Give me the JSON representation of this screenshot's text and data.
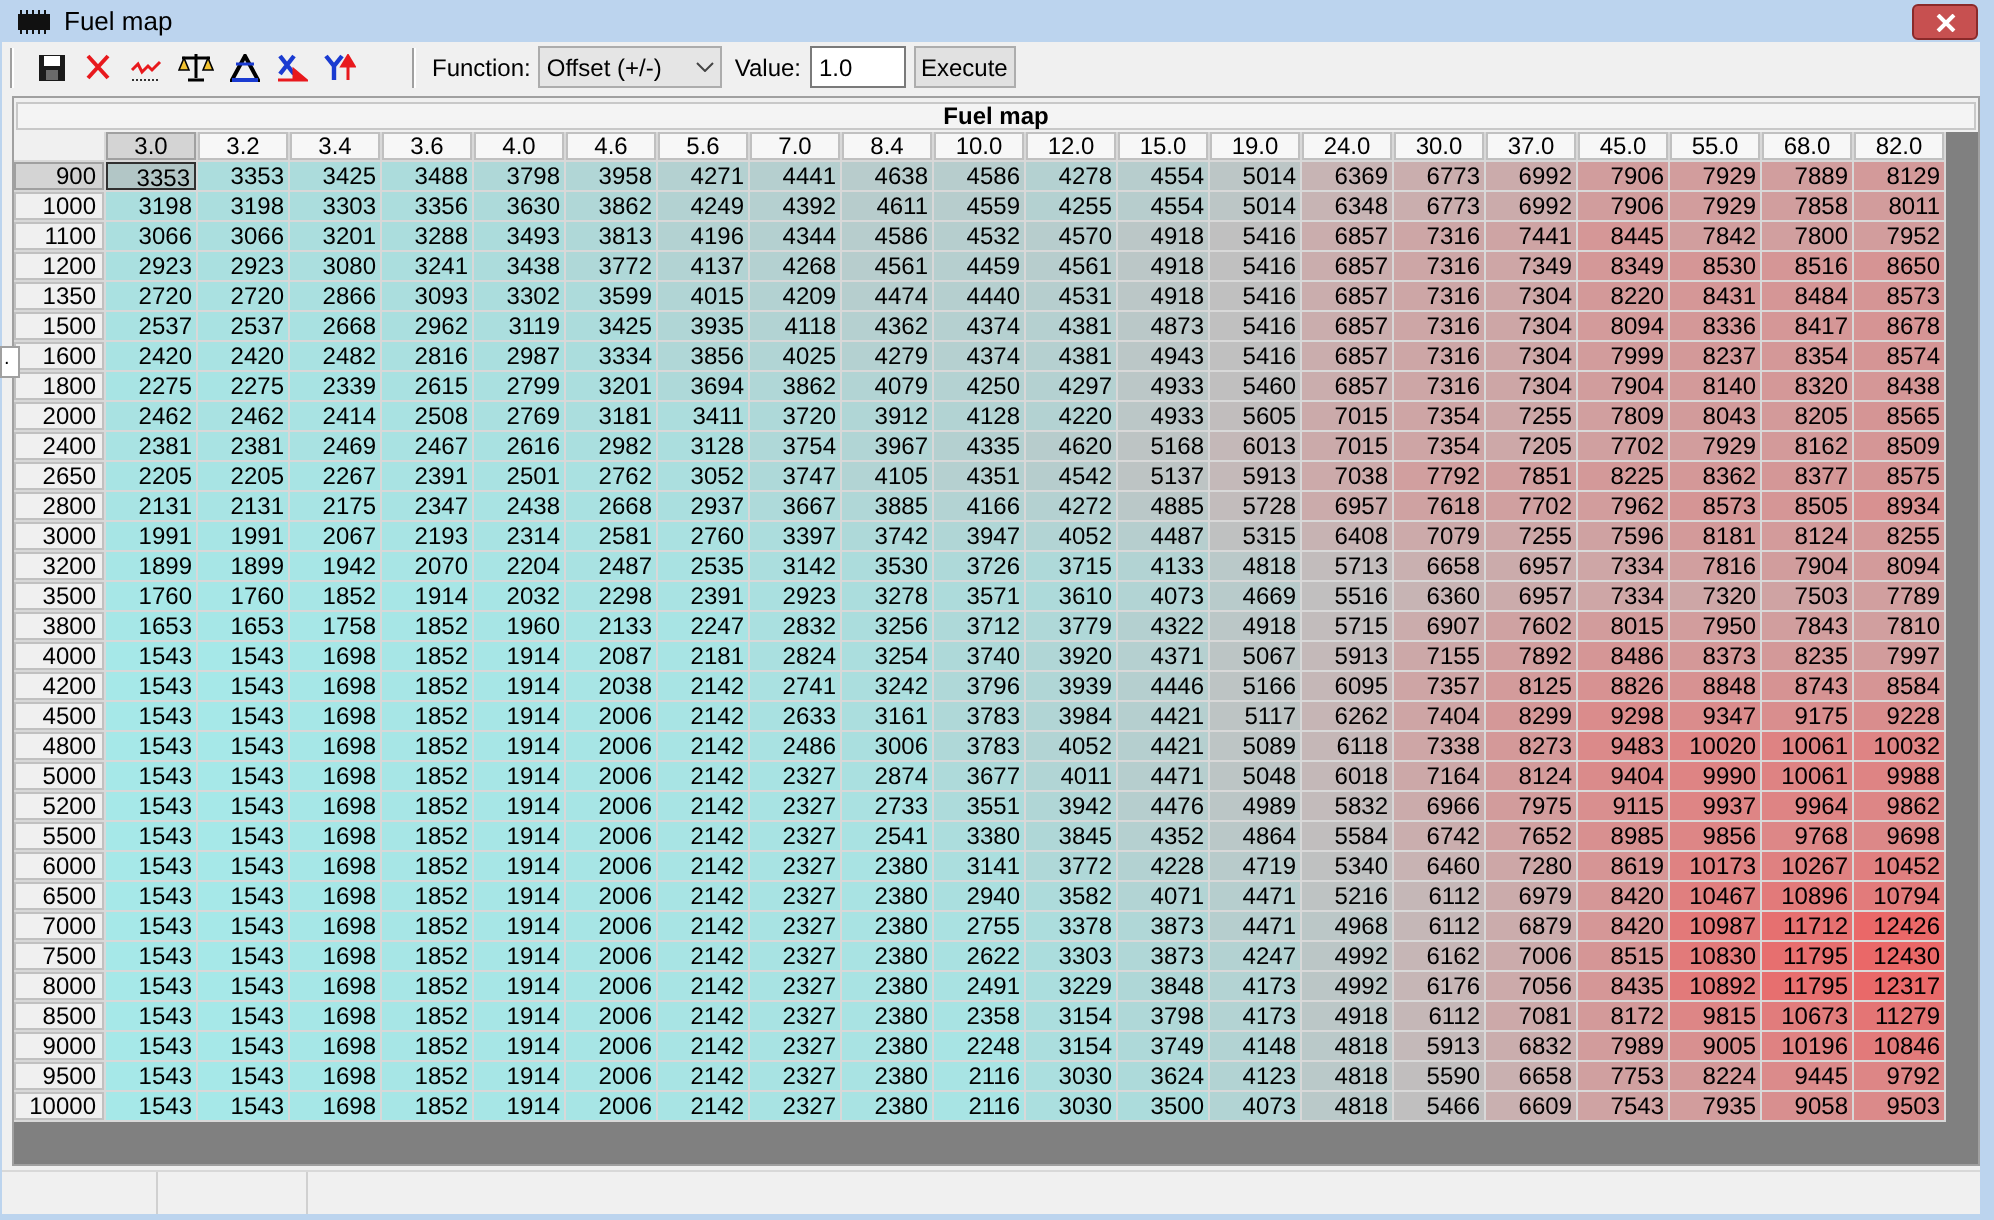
{
  "window": {
    "title": "Fuel map"
  },
  "toolbar": {
    "function_label": "Function:",
    "function_value": "Offset (+/-)",
    "value_label": "Value:",
    "value": "1.0",
    "execute": "Execute"
  },
  "side_tab": ".",
  "table": {
    "title": "Fuel map",
    "columns": [
      {
        "label": "3.0",
        "selected": true
      },
      {
        "label": "3.2",
        "selected": false
      },
      {
        "label": "3.4",
        "selected": false
      },
      {
        "label": "3.6",
        "selected": false
      },
      {
        "label": "4.0",
        "selected": false
      },
      {
        "label": "4.6",
        "selected": false
      },
      {
        "label": "5.6",
        "selected": false
      },
      {
        "label": "7.0",
        "selected": false
      },
      {
        "label": "8.4",
        "selected": false
      },
      {
        "label": "10.0",
        "selected": false
      },
      {
        "label": "12.0",
        "selected": false
      },
      {
        "label": "15.0",
        "selected": false
      },
      {
        "label": "19.0",
        "selected": false
      },
      {
        "label": "24.0",
        "selected": false
      },
      {
        "label": "30.0",
        "selected": false
      },
      {
        "label": "37.0",
        "selected": false
      },
      {
        "label": "45.0",
        "selected": false
      },
      {
        "label": "55.0",
        "selected": false
      },
      {
        "label": "68.0",
        "selected": false
      },
      {
        "label": "82.0",
        "selected": false
      }
    ],
    "rows": [
      {
        "label": "900",
        "selected": true,
        "cells": [
          "3353",
          "3353",
          "3425",
          "3488",
          "3798",
          "3958",
          "4271",
          "4441",
          "4638",
          "4586",
          "4278",
          "4554",
          "5014",
          "6369",
          "6773",
          "6992",
          "7906",
          "7929",
          "7889",
          "8129"
        ]
      },
      {
        "label": "1000",
        "selected": false,
        "cells": [
          "3198",
          "3198",
          "3303",
          "3356",
          "3630",
          "3862",
          "4249",
          "4392",
          "4611",
          "4559",
          "4255",
          "4554",
          "5014",
          "6348",
          "6773",
          "6992",
          "7906",
          "7929",
          "7858",
          "8011"
        ]
      },
      {
        "label": "1100",
        "selected": false,
        "cells": [
          "3066",
          "3066",
          "3201",
          "3288",
          "3493",
          "3813",
          "4196",
          "4344",
          "4586",
          "4532",
          "4570",
          "4918",
          "5416",
          "6857",
          "7316",
          "7441",
          "8445",
          "7842",
          "7800",
          "7952"
        ]
      },
      {
        "label": "1200",
        "selected": false,
        "cells": [
          "2923",
          "2923",
          "3080",
          "3241",
          "3438",
          "3772",
          "4137",
          "4268",
          "4561",
          "4459",
          "4561",
          "4918",
          "5416",
          "6857",
          "7316",
          "7349",
          "8349",
          "8530",
          "8516",
          "8650"
        ]
      },
      {
        "label": "1350",
        "selected": false,
        "cells": [
          "2720",
          "2720",
          "2866",
          "3093",
          "3302",
          "3599",
          "4015",
          "4209",
          "4474",
          "4440",
          "4531",
          "4918",
          "5416",
          "6857",
          "7316",
          "7304",
          "8220",
          "8431",
          "8484",
          "8573"
        ]
      },
      {
        "label": "1500",
        "selected": false,
        "cells": [
          "2537",
          "2537",
          "2668",
          "2962",
          "3119",
          "3425",
          "3935",
          "4118",
          "4362",
          "4374",
          "4381",
          "4873",
          "5416",
          "6857",
          "7316",
          "7304",
          "8094",
          "8336",
          "8417",
          "8678"
        ]
      },
      {
        "label": "1600",
        "selected": false,
        "cells": [
          "2420",
          "2420",
          "2482",
          "2816",
          "2987",
          "3334",
          "3856",
          "4025",
          "4279",
          "4374",
          "4381",
          "4943",
          "5416",
          "6857",
          "7316",
          "7304",
          "7999",
          "8237",
          "8354",
          "8574"
        ]
      },
      {
        "label": "1800",
        "selected": false,
        "cells": [
          "2275",
          "2275",
          "2339",
          "2615",
          "2799",
          "3201",
          "3694",
          "3862",
          "4079",
          "4250",
          "4297",
          "4933",
          "5460",
          "6857",
          "7316",
          "7304",
          "7904",
          "8140",
          "8320",
          "8438"
        ]
      },
      {
        "label": "2000",
        "selected": false,
        "cells": [
          "2462",
          "2462",
          "2414",
          "2508",
          "2769",
          "3181",
          "3411",
          "3720",
          "3912",
          "4128",
          "4220",
          "4933",
          "5605",
          "7015",
          "7354",
          "7255",
          "7809",
          "8043",
          "8205",
          "8565"
        ]
      },
      {
        "label": "2400",
        "selected": false,
        "cells": [
          "2381",
          "2381",
          "2469",
          "2467",
          "2616",
          "2982",
          "3128",
          "3754",
          "3967",
          "4335",
          "4620",
          "5168",
          "6013",
          "7015",
          "7354",
          "7205",
          "7702",
          "7929",
          "8162",
          "8509"
        ]
      },
      {
        "label": "2650",
        "selected": false,
        "cells": [
          "2205",
          "2205",
          "2267",
          "2391",
          "2501",
          "2762",
          "3052",
          "3747",
          "4105",
          "4351",
          "4542",
          "5137",
          "5913",
          "7038",
          "7792",
          "7851",
          "8225",
          "8362",
          "8377",
          "8575"
        ]
      },
      {
        "label": "2800",
        "selected": false,
        "cells": [
          "2131",
          "2131",
          "2175",
          "2347",
          "2438",
          "2668",
          "2937",
          "3667",
          "3885",
          "4166",
          "4272",
          "4885",
          "5728",
          "6957",
          "7618",
          "7702",
          "7962",
          "8573",
          "8505",
          "8934"
        ]
      },
      {
        "label": "3000",
        "selected": false,
        "cells": [
          "1991",
          "1991",
          "2067",
          "2193",
          "2314",
          "2581",
          "2760",
          "3397",
          "3742",
          "3947",
          "4052",
          "4487",
          "5315",
          "6408",
          "7079",
          "7255",
          "7596",
          "8181",
          "8124",
          "8255"
        ]
      },
      {
        "label": "3200",
        "selected": false,
        "cells": [
          "1899",
          "1899",
          "1942",
          "2070",
          "2204",
          "2487",
          "2535",
          "3142",
          "3530",
          "3726",
          "3715",
          "4133",
          "4818",
          "5713",
          "6658",
          "6957",
          "7334",
          "7816",
          "7904",
          "8094"
        ]
      },
      {
        "label": "3500",
        "selected": false,
        "cells": [
          "1760",
          "1760",
          "1852",
          "1914",
          "2032",
          "2298",
          "2391",
          "2923",
          "3278",
          "3571",
          "3610",
          "4073",
          "4669",
          "5516",
          "6360",
          "6957",
          "7334",
          "7320",
          "7503",
          "7789"
        ]
      },
      {
        "label": "3800",
        "selected": false,
        "cells": [
          "1653",
          "1653",
          "1758",
          "1852",
          "1960",
          "2133",
          "2247",
          "2832",
          "3256",
          "3712",
          "3779",
          "4322",
          "4918",
          "5715",
          "6907",
          "7602",
          "8015",
          "7950",
          "7843",
          "7810"
        ]
      },
      {
        "label": "4000",
        "selected": false,
        "cells": [
          "1543",
          "1543",
          "1698",
          "1852",
          "1914",
          "2087",
          "2181",
          "2824",
          "3254",
          "3740",
          "3920",
          "4371",
          "5067",
          "5913",
          "7155",
          "7892",
          "8486",
          "8373",
          "8235",
          "7997"
        ]
      },
      {
        "label": "4200",
        "selected": false,
        "cells": [
          "1543",
          "1543",
          "1698",
          "1852",
          "1914",
          "2038",
          "2142",
          "2741",
          "3242",
          "3796",
          "3939",
          "4446",
          "5166",
          "6095",
          "7357",
          "8125",
          "8826",
          "8848",
          "8743",
          "8584"
        ]
      },
      {
        "label": "4500",
        "selected": false,
        "cells": [
          "1543",
          "1543",
          "1698",
          "1852",
          "1914",
          "2006",
          "2142",
          "2633",
          "3161",
          "3783",
          "3984",
          "4421",
          "5117",
          "6262",
          "7404",
          "8299",
          "9298",
          "9347",
          "9175",
          "9228"
        ]
      },
      {
        "label": "4800",
        "selected": false,
        "cells": [
          "1543",
          "1543",
          "1698",
          "1852",
          "1914",
          "2006",
          "2142",
          "2486",
          "3006",
          "3783",
          "4052",
          "4421",
          "5089",
          "6118",
          "7338",
          "8273",
          "9483",
          "10020",
          "10061",
          "10032"
        ]
      },
      {
        "label": "5000",
        "selected": false,
        "cells": [
          "1543",
          "1543",
          "1698",
          "1852",
          "1914",
          "2006",
          "2142",
          "2327",
          "2874",
          "3677",
          "4011",
          "4471",
          "5048",
          "6018",
          "7164",
          "8124",
          "9404",
          "9990",
          "10061",
          "9988"
        ]
      },
      {
        "label": "5200",
        "selected": false,
        "cells": [
          "1543",
          "1543",
          "1698",
          "1852",
          "1914",
          "2006",
          "2142",
          "2327",
          "2733",
          "3551",
          "3942",
          "4476",
          "4989",
          "5832",
          "6966",
          "7975",
          "9115",
          "9937",
          "9964",
          "9862"
        ]
      },
      {
        "label": "5500",
        "selected": false,
        "cells": [
          "1543",
          "1543",
          "1698",
          "1852",
          "1914",
          "2006",
          "2142",
          "2327",
          "2541",
          "3380",
          "3845",
          "4352",
          "4864",
          "5584",
          "6742",
          "7652",
          "8985",
          "9856",
          "9768",
          "9698"
        ]
      },
      {
        "label": "6000",
        "selected": false,
        "cells": [
          "1543",
          "1543",
          "1698",
          "1852",
          "1914",
          "2006",
          "2142",
          "2327",
          "2380",
          "3141",
          "3772",
          "4228",
          "4719",
          "5340",
          "6460",
          "7280",
          "8619",
          "10173",
          "10267",
          "10452"
        ]
      },
      {
        "label": "6500",
        "selected": false,
        "cells": [
          "1543",
          "1543",
          "1698",
          "1852",
          "1914",
          "2006",
          "2142",
          "2327",
          "2380",
          "2940",
          "3582",
          "4071",
          "4471",
          "5216",
          "6112",
          "6979",
          "8420",
          "10467",
          "10896",
          "10794"
        ]
      },
      {
        "label": "7000",
        "selected": false,
        "cells": [
          "1543",
          "1543",
          "1698",
          "1852",
          "1914",
          "2006",
          "2142",
          "2327",
          "2380",
          "2755",
          "3378",
          "3873",
          "4471",
          "4968",
          "6112",
          "6879",
          "8420",
          "10987",
          "11712",
          "12426"
        ]
      },
      {
        "label": "7500",
        "selected": false,
        "cells": [
          "1543",
          "1543",
          "1698",
          "1852",
          "1914",
          "2006",
          "2142",
          "2327",
          "2380",
          "2622",
          "3303",
          "3873",
          "4247",
          "4992",
          "6162",
          "7006",
          "8515",
          "10830",
          "11795",
          "12430"
        ]
      },
      {
        "label": "8000",
        "selected": false,
        "cells": [
          "1543",
          "1543",
          "1698",
          "1852",
          "1914",
          "2006",
          "2142",
          "2327",
          "2380",
          "2491",
          "3229",
          "3848",
          "4173",
          "4992",
          "6176",
          "7056",
          "8435",
          "10892",
          "11795",
          "12317"
        ]
      },
      {
        "label": "8500",
        "selected": false,
        "cells": [
          "1543",
          "1543",
          "1698",
          "1852",
          "1914",
          "2006",
          "2142",
          "2327",
          "2380",
          "2358",
          "3154",
          "3798",
          "4173",
          "4918",
          "6112",
          "7081",
          "8172",
          "9815",
          "10673",
          "11279"
        ]
      },
      {
        "label": "9000",
        "selected": false,
        "cells": [
          "1543",
          "1543",
          "1698",
          "1852",
          "1914",
          "2006",
          "2142",
          "2327",
          "2380",
          "2248",
          "3154",
          "3749",
          "4148",
          "4818",
          "5913",
          "6832",
          "7989",
          "9005",
          "10196",
          "10846"
        ]
      },
      {
        "label": "9500",
        "selected": false,
        "cells": [
          "1543",
          "1543",
          "1698",
          "1852",
          "1914",
          "2006",
          "2142",
          "2327",
          "2380",
          "2116",
          "3030",
          "3624",
          "4123",
          "4818",
          "5590",
          "6658",
          "7753",
          "8224",
          "9445",
          "9792"
        ]
      },
      {
        "label": "10000",
        "selected": false,
        "cells": [
          "1543",
          "1543",
          "1698",
          "1852",
          "1914",
          "2006",
          "2142",
          "2327",
          "2380",
          "2116",
          "3030",
          "3500",
          "4073",
          "4818",
          "5466",
          "6609",
          "7543",
          "7935",
          "9058",
          "9503"
        ]
      }
    ]
  }
}
